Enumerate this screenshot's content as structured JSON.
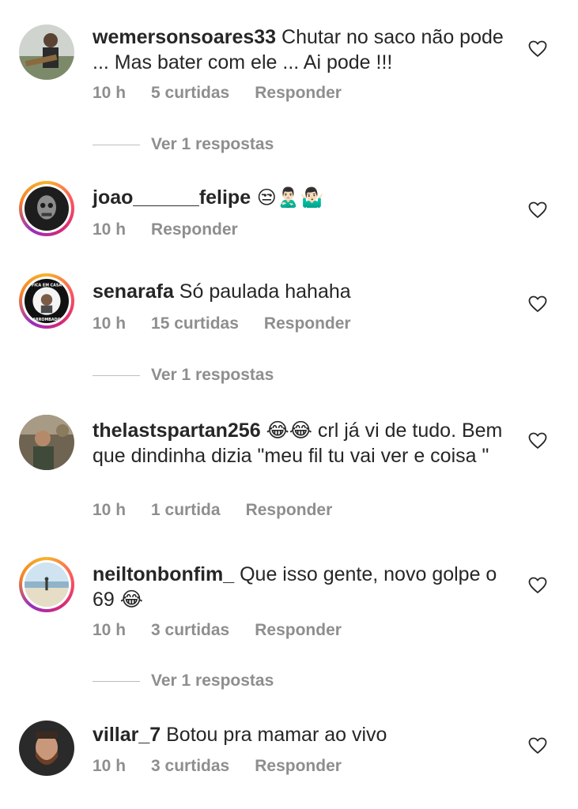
{
  "comments": [
    {
      "username": "wemersonsoares33",
      "text": " Chutar no saco não pode ... Mas bater com ele ... Ai pode !!!",
      "time": "10 h",
      "likes": "5 curtidas",
      "reply_label": "Responder",
      "view_replies": "Ver 1 respostas",
      "avatar_icon": "user-photo-guitar",
      "story_ring": false
    },
    {
      "username": "joao______felipe",
      "text": " 😒🙎🏻‍♂️🤷🏻‍♂️",
      "time": "10 h",
      "reply_label": "Responder",
      "avatar_icon": "user-photo-mask",
      "story_ring": true
    },
    {
      "username": "senarafa",
      "text": " Só paulada hahaha",
      "time": "10 h",
      "likes": "15 curtidas",
      "reply_label": "Responder",
      "view_replies": "Ver 1 respostas",
      "avatar_icon": "user-photo-badge",
      "avatar_badge_top": "FICA EM CASA",
      "avatar_badge_bottom": "ARROMBADO",
      "story_ring": true
    },
    {
      "username": "thelastspartan256",
      "text": " 😂😂 crl já vi de tudo. Bem que dindinha dizia \"meu fil tu vai ver e coisa \"",
      "time": "10 h",
      "likes": "1 curtida",
      "reply_label": "Responder",
      "avatar_icon": "user-photo-outdoor",
      "story_ring": false
    },
    {
      "username": "neiltonbonfim_",
      "text": " Que isso gente, novo golpe o 69 😂",
      "time": "10 h",
      "likes": "3 curtidas",
      "reply_label": "Responder",
      "view_replies": "Ver 1 respostas",
      "avatar_icon": "user-photo-beach",
      "story_ring": true
    },
    {
      "username": "villar_7",
      "text": " Botou pra mamar ao vivo",
      "time": "10 h",
      "likes": "3 curtidas",
      "reply_label": "Responder",
      "avatar_icon": "user-photo-beard",
      "story_ring": false
    }
  ],
  "colors": {
    "text": "#262626",
    "meta": "#8e8e8e",
    "background": "#ffffff"
  }
}
